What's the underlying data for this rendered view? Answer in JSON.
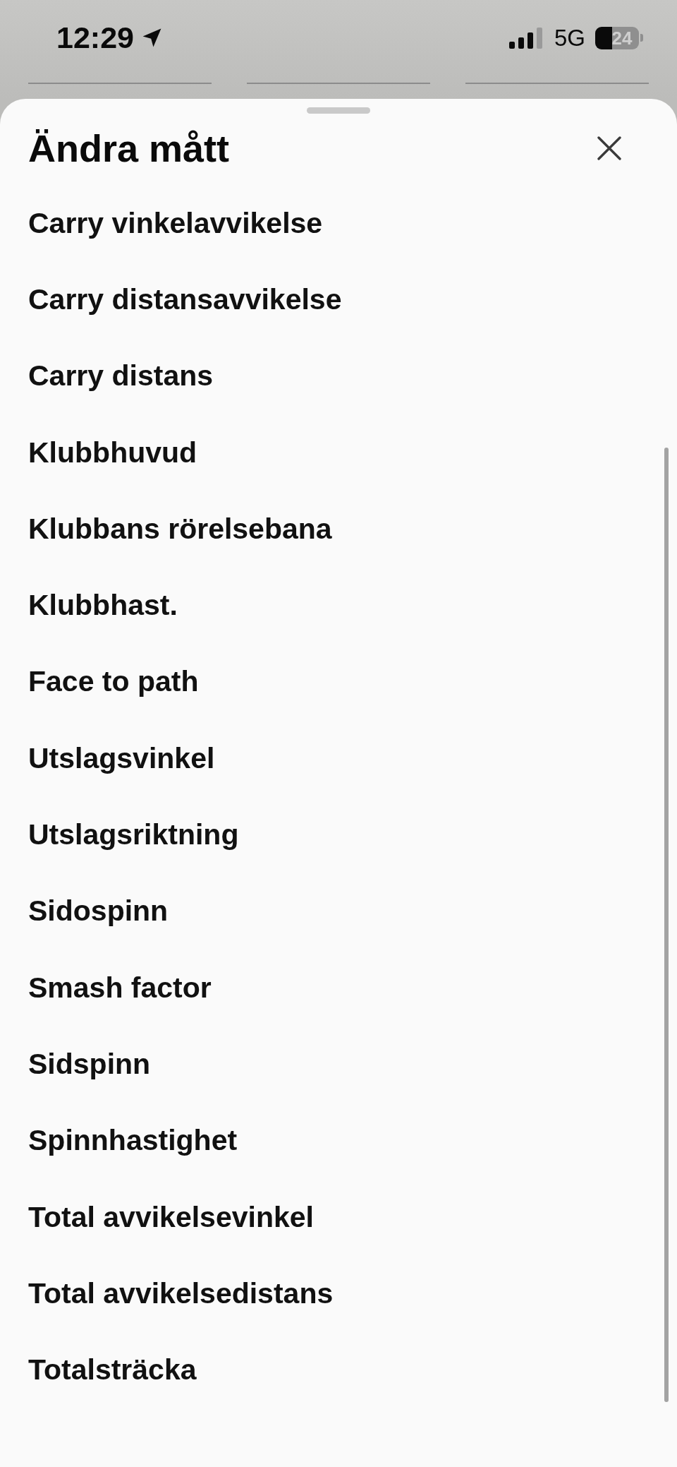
{
  "status_bar": {
    "time": "12:29",
    "network": "5G",
    "battery": "24"
  },
  "sheet": {
    "title": "Ändra mått",
    "items": [
      {
        "label": "Carry vinkelavvikelse"
      },
      {
        "label": "Carry distansavvikelse"
      },
      {
        "label": "Carry distans"
      },
      {
        "label": "Klubbhuvud"
      },
      {
        "label": "Klubbans rörelsebana"
      },
      {
        "label": "Klubbhast."
      },
      {
        "label": "Face to path"
      },
      {
        "label": "Utslagsvinkel"
      },
      {
        "label": "Utslagsriktning"
      },
      {
        "label": "Sidospinn"
      },
      {
        "label": "Smash factor"
      },
      {
        "label": "Sidspinn"
      },
      {
        "label": "Spinnhastighet"
      },
      {
        "label": "Total avvikelsevinkel"
      },
      {
        "label": "Total avvikelsedistans"
      },
      {
        "label": "Totalsträcka"
      }
    ]
  }
}
